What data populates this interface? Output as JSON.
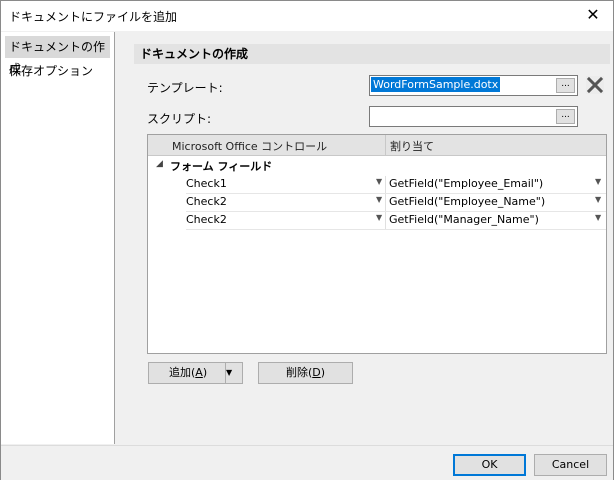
{
  "window": {
    "title": "ドキュメントにファイルを追加",
    "close_symbol": "✕"
  },
  "sidebar": {
    "items": [
      {
        "label": "ドキュメントの作成",
        "selected": true
      },
      {
        "label": "保存オプション",
        "selected": false
      }
    ]
  },
  "section": {
    "title": "ドキュメントの作成"
  },
  "form": {
    "template_label": "テンプレート:",
    "template_value": "WordFormSample.dotx",
    "script_label": "スクリプト:",
    "script_value": "",
    "browse_label": "...",
    "clear_symbol": "✕"
  },
  "grid": {
    "headers": [
      "Microsoft Office コントロール",
      "割り当て"
    ],
    "group": {
      "label": "フォーム フィールド",
      "expander": "◢"
    },
    "rows": [
      {
        "control": "Check1",
        "assignment": "GetField(\"Employee_Email\")"
      },
      {
        "control": "Check2",
        "assignment": "GetField(\"Employee_Name\")"
      },
      {
        "control": "Check2",
        "assignment": "GetField(\"Manager_Name\")"
      }
    ],
    "dropdown_symbol": "▼"
  },
  "actions": {
    "add_label": "追加(",
    "add_mnemonic": "A",
    "add_close": ")",
    "delete_label": "削除(",
    "delete_mnemonic": "D",
    "delete_close": ")"
  },
  "footer": {
    "ok_label": "OK",
    "cancel_label": "Cancel"
  }
}
